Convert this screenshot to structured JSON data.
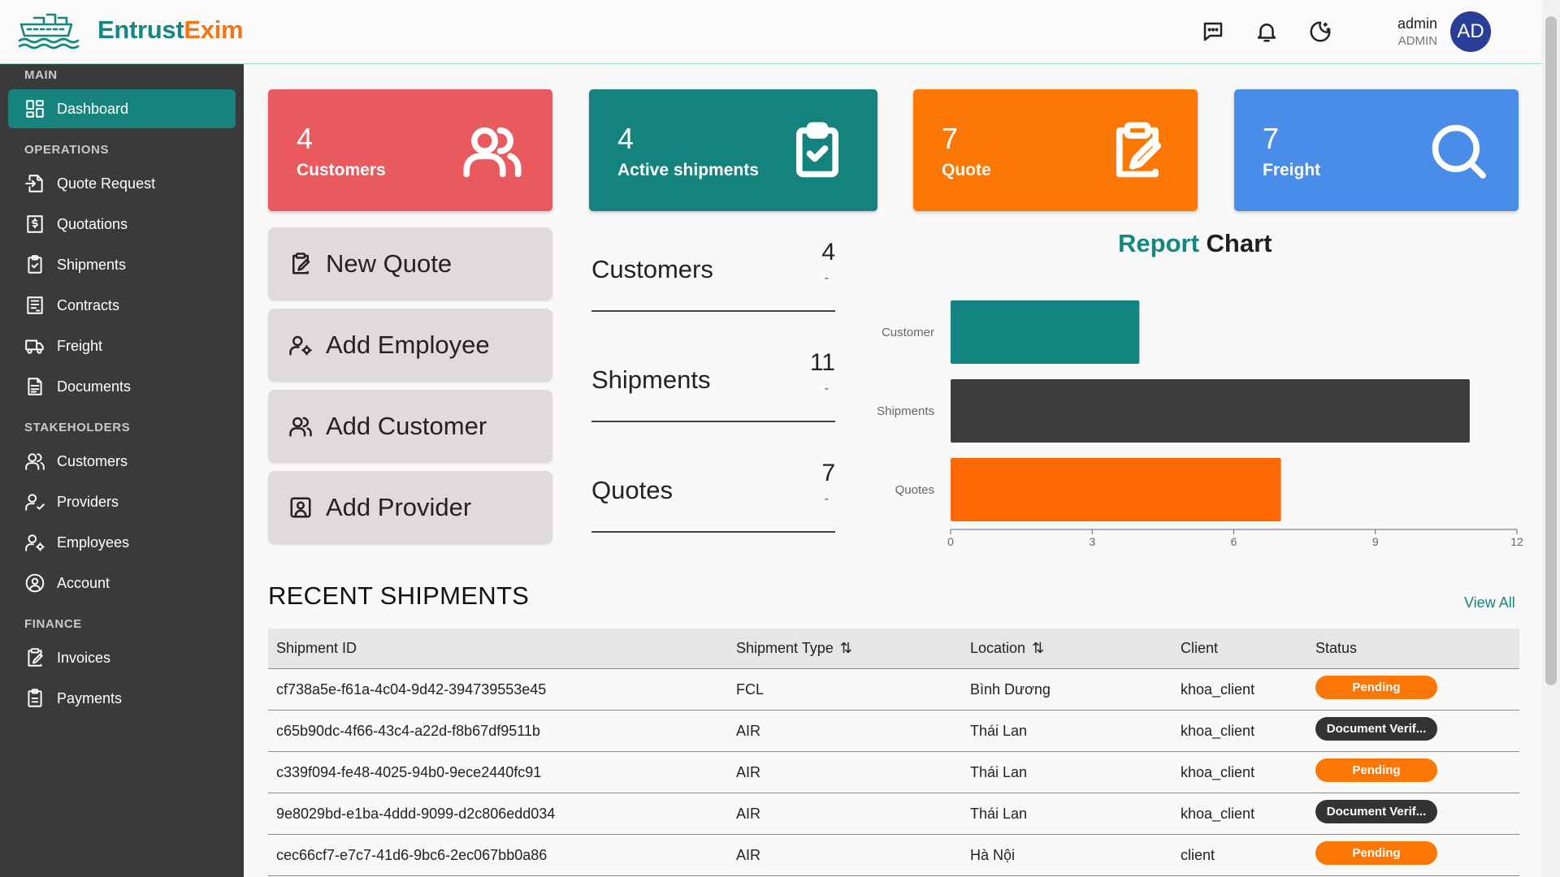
{
  "header": {
    "brand_part1": "Entrust",
    "brand_part2": "Exim",
    "icons": [
      "message-icon",
      "bell-icon",
      "theme-toggle-icon"
    ],
    "user_name": "admin",
    "user_role": "ADMIN",
    "avatar_initials": "AD"
  },
  "sidebar": {
    "sections": [
      {
        "title": "MAIN",
        "items": [
          {
            "label": "Dashboard",
            "icon": "dashboard-icon",
            "active": true
          }
        ]
      },
      {
        "title": "OPERATIONS",
        "items": [
          {
            "label": "Quote Request",
            "icon": "file-import-icon"
          },
          {
            "label": "Quotations",
            "icon": "invoice-dollar-icon"
          },
          {
            "label": "Shipments",
            "icon": "clipboard-check-icon"
          },
          {
            "label": "Contracts",
            "icon": "contract-icon"
          },
          {
            "label": "Freight",
            "icon": "truck-icon"
          },
          {
            "label": "Documents",
            "icon": "document-icon"
          }
        ]
      },
      {
        "title": "STAKEHOLDERS",
        "items": [
          {
            "label": "Customers",
            "icon": "users-icon"
          },
          {
            "label": "Providers",
            "icon": "user-check-icon"
          },
          {
            "label": "Employees",
            "icon": "user-cog-icon"
          },
          {
            "label": "Account",
            "icon": "user-circle-icon"
          }
        ]
      },
      {
        "title": "FINANCE",
        "items": [
          {
            "label": "Invoices",
            "icon": "invoice-edit-icon"
          },
          {
            "label": "Payments",
            "icon": "clipboard-icon"
          }
        ]
      }
    ]
  },
  "stats": [
    {
      "value": "4",
      "label": "Customers",
      "color": "#e95a5e",
      "icon": "users-icon"
    },
    {
      "value": "4",
      "label": "Active shipments",
      "color": "#15837d",
      "icon": "clipboard-check-icon"
    },
    {
      "value": "7",
      "label": "Quote",
      "color": "#fd7704",
      "icon": "clipboard-edit-icon"
    },
    {
      "value": "7",
      "label": "Freight",
      "color": "#4a8de8",
      "icon": "search-icon"
    }
  ],
  "quick_actions": [
    {
      "label": "New Quote",
      "icon": "clipboard-edit-icon"
    },
    {
      "label": "Add Employee",
      "icon": "user-cog-icon"
    },
    {
      "label": "Add Customer",
      "icon": "users-icon"
    },
    {
      "label": "Add Provider",
      "icon": "user-square-icon"
    }
  ],
  "summary": [
    {
      "label": "Customers",
      "value": "4",
      "sub": "-"
    },
    {
      "label": "Shipments",
      "value": "11",
      "sub": "-"
    },
    {
      "label": "Quotes",
      "value": "7",
      "sub": "-"
    }
  ],
  "chart_title_part1": "Report",
  "chart_title_part2": "Chart",
  "chart_data": {
    "type": "bar",
    "orientation": "horizontal",
    "title": "Report Chart",
    "categories": [
      "Customer",
      "Shipments",
      "Quotes"
    ],
    "values": [
      4,
      11,
      7
    ],
    "colors": [
      "#138580",
      "#3c3c3c",
      "#fe6805"
    ],
    "xlim": [
      0,
      12
    ],
    "xticks": [
      0,
      3,
      6,
      9,
      12
    ],
    "grid": false,
    "legend": "none"
  },
  "recent": {
    "title": "RECENT SHIPMENTS",
    "view_all": "View All",
    "columns": [
      "Shipment ID",
      "Shipment Type",
      "Location",
      "Client",
      "Status"
    ],
    "sortable": [
      false,
      true,
      true,
      false,
      false
    ],
    "rows": [
      {
        "id": "cf738a5e-f61a-4c04-9d42-394739553e45",
        "type": "FCL",
        "location": "Bình Dương",
        "client": "khoa_client",
        "status": "Pending",
        "status_kind": "pending"
      },
      {
        "id": "c65b90dc-4f66-43c4-a22d-f8b67df9511b",
        "type": "AIR",
        "location": "Thái Lan",
        "client": "khoa_client",
        "status": "Document Verif...",
        "status_kind": "doc"
      },
      {
        "id": "c339f094-fe48-4025-94b0-9ece2440fc91",
        "type": "AIR",
        "location": "Thái Lan",
        "client": "khoa_client",
        "status": "Pending",
        "status_kind": "pending"
      },
      {
        "id": "9e8029bd-e1ba-4ddd-9099-d2c806edd034",
        "type": "AIR",
        "location": "Thái Lan",
        "client": "khoa_client",
        "status": "Document Verif...",
        "status_kind": "doc"
      },
      {
        "id": "cec66cf7-e7c7-41d6-9bc6-2ec067bb0a86",
        "type": "AIR",
        "location": "Hà Nội",
        "client": "client",
        "status": "Pending",
        "status_kind": "pending"
      }
    ]
  }
}
